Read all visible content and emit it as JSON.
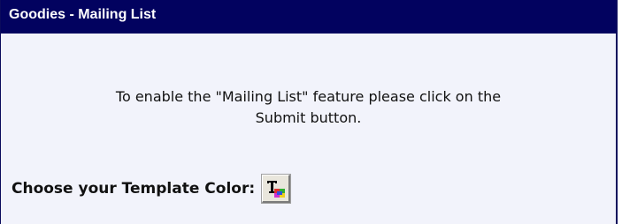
{
  "header": {
    "title": "Goodies - Mailing List"
  },
  "main": {
    "message_line1": "To enable the \"Mailing List\" feature please click on the",
    "message_line2": "Submit button.",
    "color_label": "Choose your Template Color:",
    "color_button_icon": "template-color-icon"
  },
  "colors": {
    "header_bg": "#02025f",
    "panel_bg": "#f2f3fb"
  }
}
